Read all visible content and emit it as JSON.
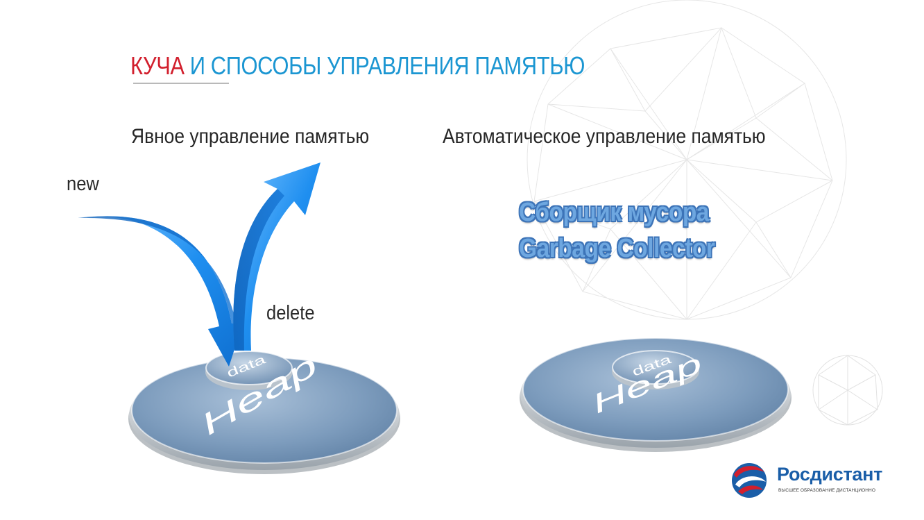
{
  "slide": {
    "title_red": "КУЧА",
    "title_blue": " И СПОСОБЫ УПРАВЛЕНИЯ ПАМЯТЬЮ",
    "left_heading": "Явное управление памятью",
    "right_heading": "Автоматическое управление памятью",
    "label_new": "new",
    "label_delete": "delete",
    "gc_line1": "Сборщик мусора",
    "gc_line2": "Garbage Collector",
    "heap_text": "Heap",
    "data_text": "data"
  },
  "logo": {
    "name_part1": "Рос",
    "name_part2": "дистант",
    "tagline": "ВЫСШЕЕ ОБРАЗОВАНИЕ ДИСТАНЦИОННО"
  },
  "colors": {
    "title_red": "#d21f2d",
    "title_blue": "#1b96d2",
    "arrow_blue": "#1e88e5",
    "disk_blue": "#6f93b6",
    "logo_blue": "#1a5ea8"
  }
}
